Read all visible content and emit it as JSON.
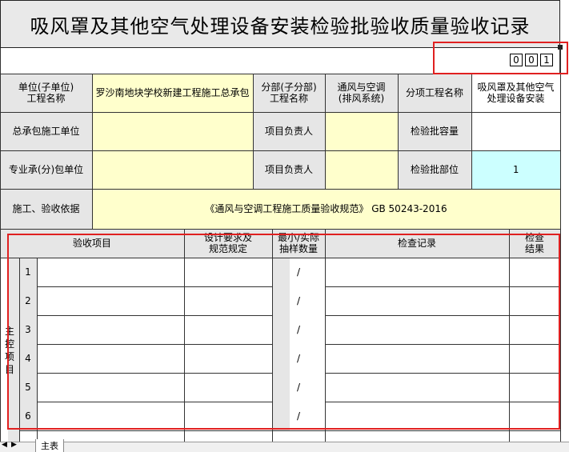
{
  "title": "吸风罩及其他空气处理设备安装检验批验收质量验收记录",
  "code_digits": [
    "0",
    "0",
    "1"
  ],
  "info": {
    "unit_label": "单位(子单位)\n工程名称",
    "unit_value": "罗沙南地块学校新建工程施工总承包",
    "division_label": "分部(子分部)\n工程名称",
    "division_value": "通风与空调\n(排风系统)",
    "subitem_label": "分项工程名称",
    "subitem_value": "吸风罩及其他空气处理设备安装",
    "gc_label": "总承包施工单位",
    "pm_label": "项目负责人",
    "capacity_label": "检验批容量",
    "sub_label": "专业承(分)包单位",
    "pm2_label": "项目负责人",
    "part_label": "检验批部位",
    "part_value": "1",
    "basis_label": "施工、验收依据",
    "basis_value": "《通风与空调工程施工质量验收规范》 GB 50243-2016"
  },
  "table_header": {
    "item": "验收项目",
    "design": "设计要求及\n规范规定",
    "sample": "最小/实际\n抽样数量",
    "record": "检查记录",
    "result": "检查\n结果"
  },
  "main_label": "主\n控\n项\n目",
  "rows": [
    {
      "num": "1",
      "sample": "/"
    },
    {
      "num": "2",
      "sample": "/"
    },
    {
      "num": "3",
      "sample": "/"
    },
    {
      "num": "4",
      "sample": "/"
    },
    {
      "num": "5",
      "sample": "/"
    },
    {
      "num": "6",
      "sample": "/"
    }
  ],
  "sheet_tab": "主表"
}
